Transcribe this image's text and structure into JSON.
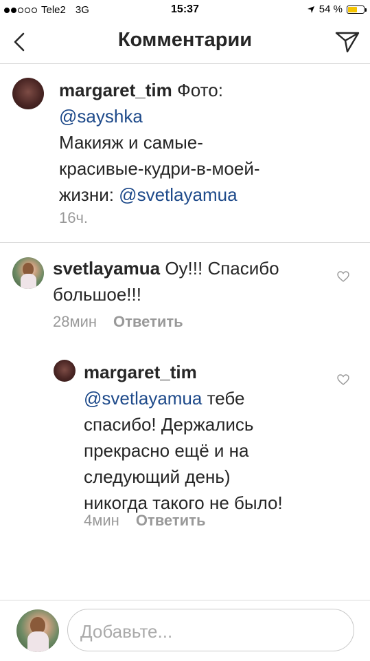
{
  "status_bar": {
    "carrier": "Tele2",
    "network": "3G",
    "time": "15:37",
    "battery": "54 %"
  },
  "header": {
    "title": "Комментарии"
  },
  "caption": {
    "username": "margaret_tim",
    "text_before": " Фото: ",
    "mention1": "@sayshka",
    "text_line2": "Макияж и самые-",
    "text_line3": "красивые-кудри-в-моей-",
    "text_line4_prefix": "жизни: ",
    "mention2": "@svetlayamua",
    "time": "16ч."
  },
  "comments": [
    {
      "username": "svetlayamua",
      "text_first": " Оу!!! Спасибо",
      "text_second": "большое!!!",
      "time": "28мин",
      "reply_label": "Ответить"
    },
    {
      "username": "margaret_tim",
      "mention": "@svetlayamua",
      "line1_rest": " тебе",
      "line2": "спасибо! Держались",
      "line3": "прекрасно ещё и на",
      "line4": "следующий день)",
      "line5": "никогда такого не было!",
      "time": "4мин",
      "reply_label": "Ответить"
    }
  ],
  "composer": {
    "placeholder": "Добавьте..."
  }
}
